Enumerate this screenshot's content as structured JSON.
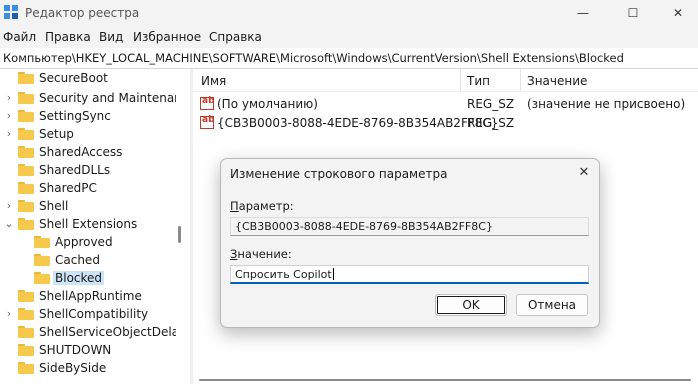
{
  "window": {
    "title": "Редактор реестра",
    "minimize_glyph": "—",
    "maximize_glyph": "☐",
    "close_glyph": "✕"
  },
  "menu": [
    "Файл",
    "Правка",
    "Вид",
    "Избранное",
    "Справка"
  ],
  "address": "Компьютер\\HKEY_LOCAL_MACHINE\\SOFTWARE\\Microsoft\\Windows\\CurrentVersion\\Shell Extensions\\Blocked",
  "tree": [
    {
      "label": "SecureBoot",
      "expander": "",
      "selected": false
    },
    {
      "label": "Security and Maintenanc",
      "expander": "›",
      "selected": false
    },
    {
      "label": "SettingSync",
      "expander": "›",
      "selected": false
    },
    {
      "label": "Setup",
      "expander": "›",
      "selected": false
    },
    {
      "label": "SharedAccess",
      "expander": "",
      "selected": false
    },
    {
      "label": "SharedDLLs",
      "expander": "",
      "selected": false
    },
    {
      "label": "SharedPC",
      "expander": "",
      "selected": false
    },
    {
      "label": "Shell",
      "expander": "›",
      "selected": false
    },
    {
      "label": "Shell Extensions",
      "expander": "⌄",
      "selected": false
    },
    {
      "label": "Approved",
      "expander": "",
      "selected": false
    },
    {
      "label": "Cached",
      "expander": "",
      "selected": false
    },
    {
      "label": "Blocked",
      "expander": "",
      "selected": true
    },
    {
      "label": "ShellAppRuntime",
      "expander": "",
      "selected": false
    },
    {
      "label": "ShellCompatibility",
      "expander": "›",
      "selected": false
    },
    {
      "label": "ShellServiceObjectDelayL",
      "expander": "",
      "selected": false
    },
    {
      "label": "SHUTDOWN",
      "expander": "",
      "selected": false
    },
    {
      "label": "SideBySide",
      "expander": "",
      "selected": false
    }
  ],
  "list": {
    "columns": [
      "Имя",
      "Тип",
      "Значение"
    ],
    "rows": [
      {
        "icon": "ab",
        "name": "(По умолчанию)",
        "type": "REG_SZ",
        "value": "(значение не присвоено)"
      },
      {
        "icon": "ab",
        "name": "{CB3B0003-8088-4EDE-8769-8B354AB2FF8C}",
        "type": "REG_SZ",
        "value": ""
      }
    ]
  },
  "dialog": {
    "title": "Изменение строкового параметра",
    "close_glyph": "✕",
    "param_label_u": "П",
    "param_label_rest": "араметр:",
    "param_value": "{CB3B0003-8088-4EDE-8769-8B354AB2FF8C}",
    "value_label_u": "З",
    "value_label_rest": "начение:",
    "value_text": "Спросить Copilot",
    "ok": "OK",
    "cancel": "Отмена"
  },
  "colors": {
    "selection": "#cce4f7",
    "accent": "#005fb8",
    "folder": "#f6c84c",
    "string_icon": "#c0392b"
  }
}
